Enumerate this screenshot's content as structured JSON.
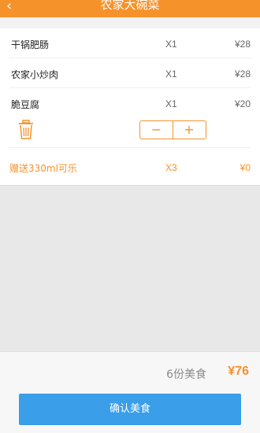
{
  "header": {
    "title": "农家大碗菜"
  },
  "order": {
    "items": [
      {
        "name": "干锅肥肠",
        "qty": "X1",
        "price": "¥28"
      },
      {
        "name": "农家小炒肉",
        "qty": "X1",
        "price": "¥28"
      },
      {
        "name": "脆豆腐",
        "qty": "X1",
        "price": "¥20"
      }
    ],
    "stepper": {
      "minus": "−",
      "plus": "+"
    },
    "gift": {
      "name": "赠送330ml可乐",
      "qty": "X3",
      "price": "¥0"
    }
  },
  "summary": {
    "count_text": "6份美食",
    "total": "¥76"
  },
  "action": {
    "confirm_label": "确认美食"
  },
  "colors": {
    "accent": "#f5922a",
    "button": "#3a9ee8"
  }
}
